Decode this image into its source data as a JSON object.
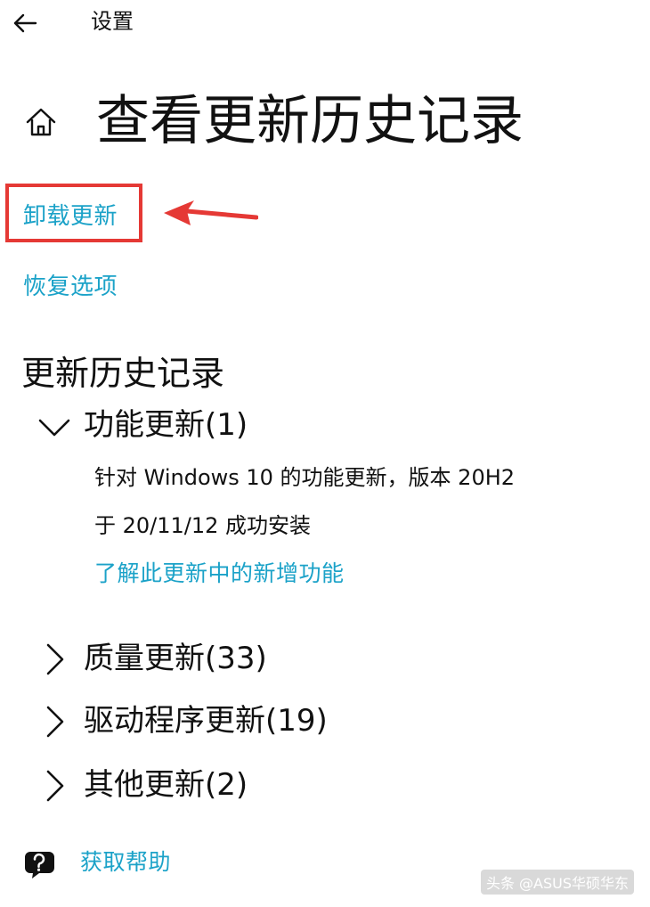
{
  "app": {
    "title": "设置"
  },
  "header": {
    "page_title": "查看更新历史记录"
  },
  "links": {
    "uninstall_updates": "卸载更新",
    "recovery_options": "恢复选项"
  },
  "history": {
    "section_title": "更新历史记录",
    "feature_updates": {
      "label": "功能更新(1)",
      "expanded": true,
      "entry_title": "针对 Windows 10 的功能更新，版本 20H2",
      "entry_status": "于 20/11/12 成功安装",
      "learn_more": "了解此更新中的新增功能"
    },
    "quality_updates": {
      "label": "质量更新(33)"
    },
    "driver_updates": {
      "label": "驱动程序更新(19)"
    },
    "other_updates": {
      "label": "其他更新(2)"
    }
  },
  "help": {
    "label": "获取帮助"
  },
  "watermark": {
    "text": "头条 @ASUS华硕华东"
  },
  "colors": {
    "accent_link": "#1ba2c8",
    "highlight_red": "#e53935",
    "text": "#111111",
    "background": "#ffffff"
  },
  "icons": {
    "back": "back-arrow-icon",
    "home": "home-icon",
    "chevron_down": "chevron-down-icon",
    "chevron_right": "chevron-right-icon",
    "help": "help-chat-icon",
    "annotation_arrow": "red-arrow-icon"
  }
}
